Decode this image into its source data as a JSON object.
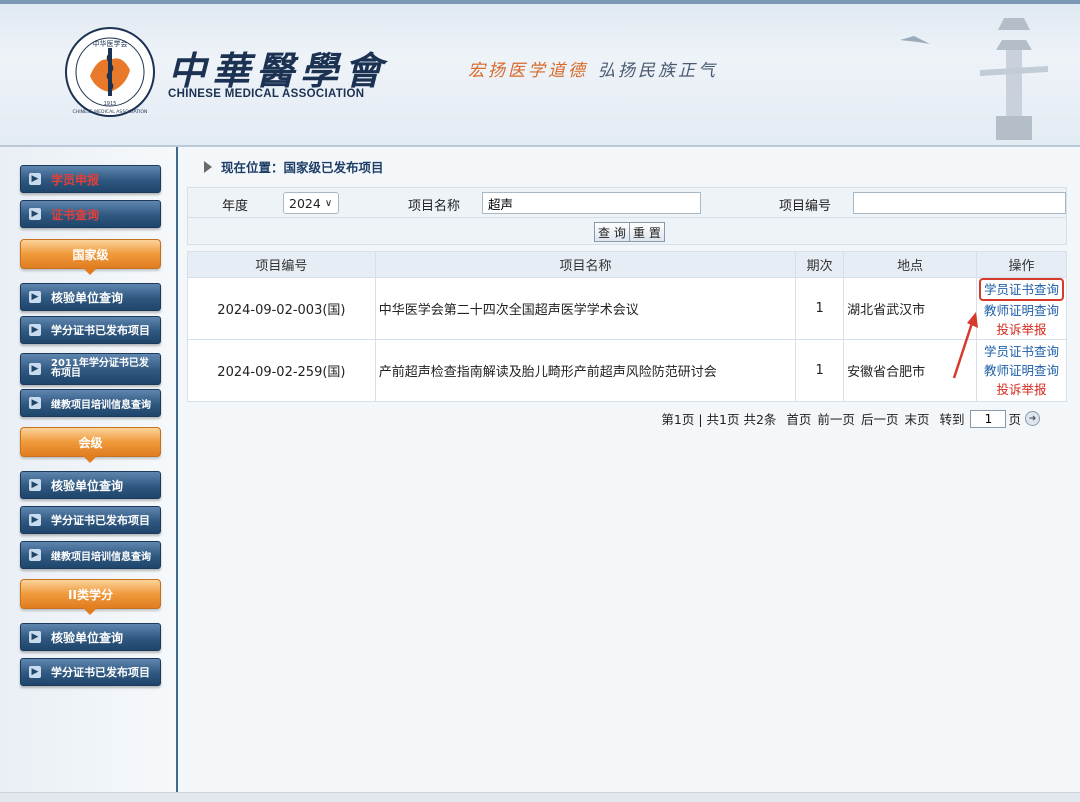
{
  "header": {
    "logo_inner": "中华医学会",
    "logo_ring_text": "CHINESE MEDICAL ASSOCIATION",
    "logo_year": "1915",
    "brand_cn": "中華醫學會",
    "brand_en": "CHINESE MEDICAL ASSOCIATION",
    "slogan_1": "宏扬医学道德",
    "slogan_2": "弘扬民族正气"
  },
  "sidebar": {
    "top_items": [
      {
        "label": "学员申报"
      },
      {
        "label": "证书查询"
      }
    ],
    "sections": [
      {
        "title": "国家级",
        "items": [
          "核验单位查询",
          "学分证书已发布项目",
          "2011年学分证书已发布项目",
          "继教项目培训信息查询"
        ]
      },
      {
        "title": "会级",
        "items": [
          "核验单位查询",
          "学分证书已发布项目",
          "继教项目培训信息查询"
        ]
      },
      {
        "title": "II类学分",
        "items": [
          "核验单位查询",
          "学分证书已发布项目"
        ]
      }
    ]
  },
  "breadcrumb": {
    "label": "现在位置：国家级已发布项目"
  },
  "search": {
    "year_label": "年度",
    "year_value": "2024",
    "name_label": "项目名称",
    "name_value": "超声",
    "code_label": "项目编号",
    "code_value": "",
    "query_button": "查 询",
    "reset_button": "重 置"
  },
  "table": {
    "headers": [
      "项目编号",
      "项目名称",
      "期次",
      "地点",
      "操作"
    ],
    "rows": [
      {
        "code": "2024-09-02-003(国)",
        "name": "中华医学会第二十四次全国超声医学学术会议",
        "period": "1",
        "location": "湖北省武汉市",
        "ops": [
          "学员证书查询",
          "教师证明查询",
          "投诉举报"
        ]
      },
      {
        "code": "2024-09-02-259(国)",
        "name": "产前超声检查指南解读及胎儿畸形产前超声风险防范研讨会",
        "period": "1",
        "location": "安徽省合肥市",
        "ops": [
          "学员证书查询",
          "教师证明查询",
          "投诉举报"
        ]
      }
    ]
  },
  "pager": {
    "summary": "第1页 | 共1页 共2条",
    "first": "首页",
    "prev": "前一页",
    "next": "后一页",
    "last": "末页",
    "goto_label": "转到",
    "goto_value": "1",
    "page_suffix": "页"
  },
  "colors": {
    "nav_blue": "#2f5880",
    "nav_orange": "#f09a3c",
    "link_blue": "#1d5fa8",
    "link_red": "#d6281d",
    "highlight": "#d63a2c"
  }
}
